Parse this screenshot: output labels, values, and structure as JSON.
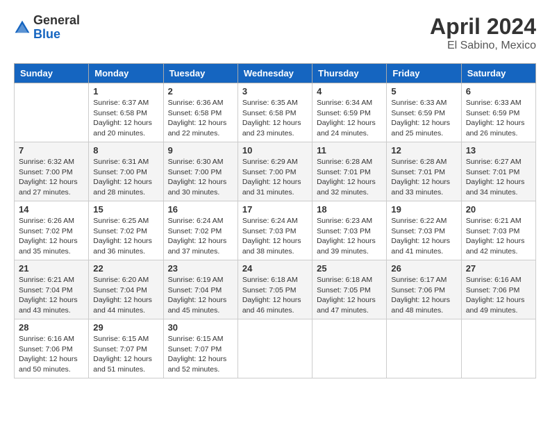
{
  "header": {
    "logo_general": "General",
    "logo_blue": "Blue",
    "month_title": "April 2024",
    "location": "El Sabino, Mexico"
  },
  "weekdays": [
    "Sunday",
    "Monday",
    "Tuesday",
    "Wednesday",
    "Thursday",
    "Friday",
    "Saturday"
  ],
  "weeks": [
    [
      {
        "num": "",
        "info": ""
      },
      {
        "num": "1",
        "info": "Sunrise: 6:37 AM\nSunset: 6:58 PM\nDaylight: 12 hours\nand 20 minutes."
      },
      {
        "num": "2",
        "info": "Sunrise: 6:36 AM\nSunset: 6:58 PM\nDaylight: 12 hours\nand 22 minutes."
      },
      {
        "num": "3",
        "info": "Sunrise: 6:35 AM\nSunset: 6:58 PM\nDaylight: 12 hours\nand 23 minutes."
      },
      {
        "num": "4",
        "info": "Sunrise: 6:34 AM\nSunset: 6:59 PM\nDaylight: 12 hours\nand 24 minutes."
      },
      {
        "num": "5",
        "info": "Sunrise: 6:33 AM\nSunset: 6:59 PM\nDaylight: 12 hours\nand 25 minutes."
      },
      {
        "num": "6",
        "info": "Sunrise: 6:33 AM\nSunset: 6:59 PM\nDaylight: 12 hours\nand 26 minutes."
      }
    ],
    [
      {
        "num": "7",
        "info": "Sunrise: 6:32 AM\nSunset: 7:00 PM\nDaylight: 12 hours\nand 27 minutes."
      },
      {
        "num": "8",
        "info": "Sunrise: 6:31 AM\nSunset: 7:00 PM\nDaylight: 12 hours\nand 28 minutes."
      },
      {
        "num": "9",
        "info": "Sunrise: 6:30 AM\nSunset: 7:00 PM\nDaylight: 12 hours\nand 30 minutes."
      },
      {
        "num": "10",
        "info": "Sunrise: 6:29 AM\nSunset: 7:00 PM\nDaylight: 12 hours\nand 31 minutes."
      },
      {
        "num": "11",
        "info": "Sunrise: 6:28 AM\nSunset: 7:01 PM\nDaylight: 12 hours\nand 32 minutes."
      },
      {
        "num": "12",
        "info": "Sunrise: 6:28 AM\nSunset: 7:01 PM\nDaylight: 12 hours\nand 33 minutes."
      },
      {
        "num": "13",
        "info": "Sunrise: 6:27 AM\nSunset: 7:01 PM\nDaylight: 12 hours\nand 34 minutes."
      }
    ],
    [
      {
        "num": "14",
        "info": "Sunrise: 6:26 AM\nSunset: 7:02 PM\nDaylight: 12 hours\nand 35 minutes."
      },
      {
        "num": "15",
        "info": "Sunrise: 6:25 AM\nSunset: 7:02 PM\nDaylight: 12 hours\nand 36 minutes."
      },
      {
        "num": "16",
        "info": "Sunrise: 6:24 AM\nSunset: 7:02 PM\nDaylight: 12 hours\nand 37 minutes."
      },
      {
        "num": "17",
        "info": "Sunrise: 6:24 AM\nSunset: 7:03 PM\nDaylight: 12 hours\nand 38 minutes."
      },
      {
        "num": "18",
        "info": "Sunrise: 6:23 AM\nSunset: 7:03 PM\nDaylight: 12 hours\nand 39 minutes."
      },
      {
        "num": "19",
        "info": "Sunrise: 6:22 AM\nSunset: 7:03 PM\nDaylight: 12 hours\nand 41 minutes."
      },
      {
        "num": "20",
        "info": "Sunrise: 6:21 AM\nSunset: 7:03 PM\nDaylight: 12 hours\nand 42 minutes."
      }
    ],
    [
      {
        "num": "21",
        "info": "Sunrise: 6:21 AM\nSunset: 7:04 PM\nDaylight: 12 hours\nand 43 minutes."
      },
      {
        "num": "22",
        "info": "Sunrise: 6:20 AM\nSunset: 7:04 PM\nDaylight: 12 hours\nand 44 minutes."
      },
      {
        "num": "23",
        "info": "Sunrise: 6:19 AM\nSunset: 7:04 PM\nDaylight: 12 hours\nand 45 minutes."
      },
      {
        "num": "24",
        "info": "Sunrise: 6:18 AM\nSunset: 7:05 PM\nDaylight: 12 hours\nand 46 minutes."
      },
      {
        "num": "25",
        "info": "Sunrise: 6:18 AM\nSunset: 7:05 PM\nDaylight: 12 hours\nand 47 minutes."
      },
      {
        "num": "26",
        "info": "Sunrise: 6:17 AM\nSunset: 7:06 PM\nDaylight: 12 hours\nand 48 minutes."
      },
      {
        "num": "27",
        "info": "Sunrise: 6:16 AM\nSunset: 7:06 PM\nDaylight: 12 hours\nand 49 minutes."
      }
    ],
    [
      {
        "num": "28",
        "info": "Sunrise: 6:16 AM\nSunset: 7:06 PM\nDaylight: 12 hours\nand 50 minutes."
      },
      {
        "num": "29",
        "info": "Sunrise: 6:15 AM\nSunset: 7:07 PM\nDaylight: 12 hours\nand 51 minutes."
      },
      {
        "num": "30",
        "info": "Sunrise: 6:15 AM\nSunset: 7:07 PM\nDaylight: 12 hours\nand 52 minutes."
      },
      {
        "num": "",
        "info": ""
      },
      {
        "num": "",
        "info": ""
      },
      {
        "num": "",
        "info": ""
      },
      {
        "num": "",
        "info": ""
      }
    ]
  ]
}
